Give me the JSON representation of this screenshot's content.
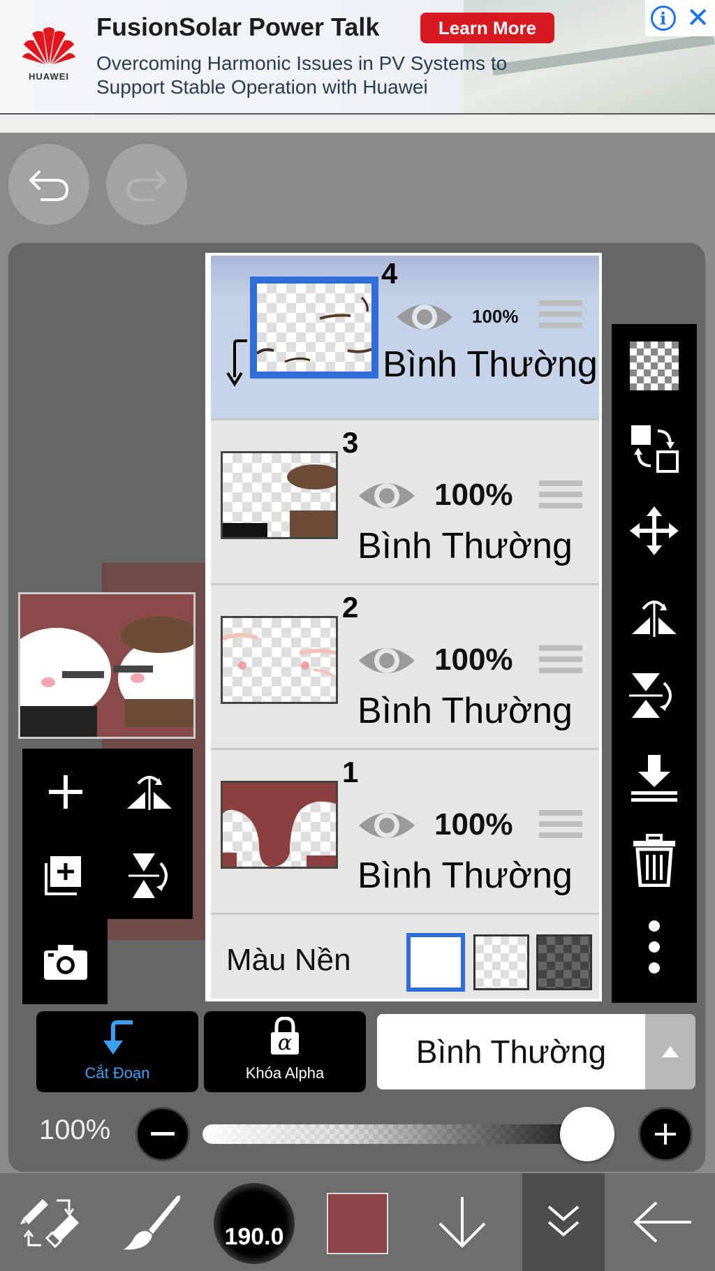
{
  "ad": {
    "title": "FusionSolar Power Talk",
    "cta": "Learn More",
    "line1": "Overcoming Harmonic Issues in PV Systems to",
    "line2": "Support Stable Operation with Huawei",
    "brand": "HUAWEI",
    "info_icon": "i",
    "close_icon": "✕"
  },
  "layers": [
    {
      "number": "4",
      "opacity": "100%",
      "blend": "Bình Thường",
      "selected": true
    },
    {
      "number": "3",
      "opacity": "100%",
      "blend": "Bình Thường",
      "selected": false
    },
    {
      "number": "2",
      "opacity": "100%",
      "blend": "Bình Thường",
      "selected": false
    },
    {
      "number": "1",
      "opacity": "100%",
      "blend": "Bình Thường",
      "selected": false
    }
  ],
  "background": {
    "label": "Màu Nền"
  },
  "actions": {
    "clip_label": "Cắt Đoạn",
    "alpha_label": "Khóa Alpha",
    "alpha_symbol": "α",
    "blend_mode": "Bình Thường"
  },
  "opacity_slider": {
    "label": "100%",
    "value": 1.0
  },
  "brush": {
    "size": "190.0"
  },
  "colors": {
    "accent_blue": "#2f6ed8",
    "current_color": "#8b4346",
    "ad_red": "#d7181f"
  },
  "icons": {
    "undo": "undo-icon",
    "redo": "redo-icon",
    "add_layer": "plus-icon",
    "duplicate_layer": "duplicate-icon",
    "camera": "camera-icon",
    "flip_horizontal": "flip-horizontal-icon",
    "flip_vertical": "flip-vertical-icon",
    "transparent": "checker-icon",
    "swap": "swap-icon",
    "move": "move-icon",
    "merge_down": "merge-down-icon",
    "delete": "trash-icon",
    "more": "more-vertical-icon"
  }
}
